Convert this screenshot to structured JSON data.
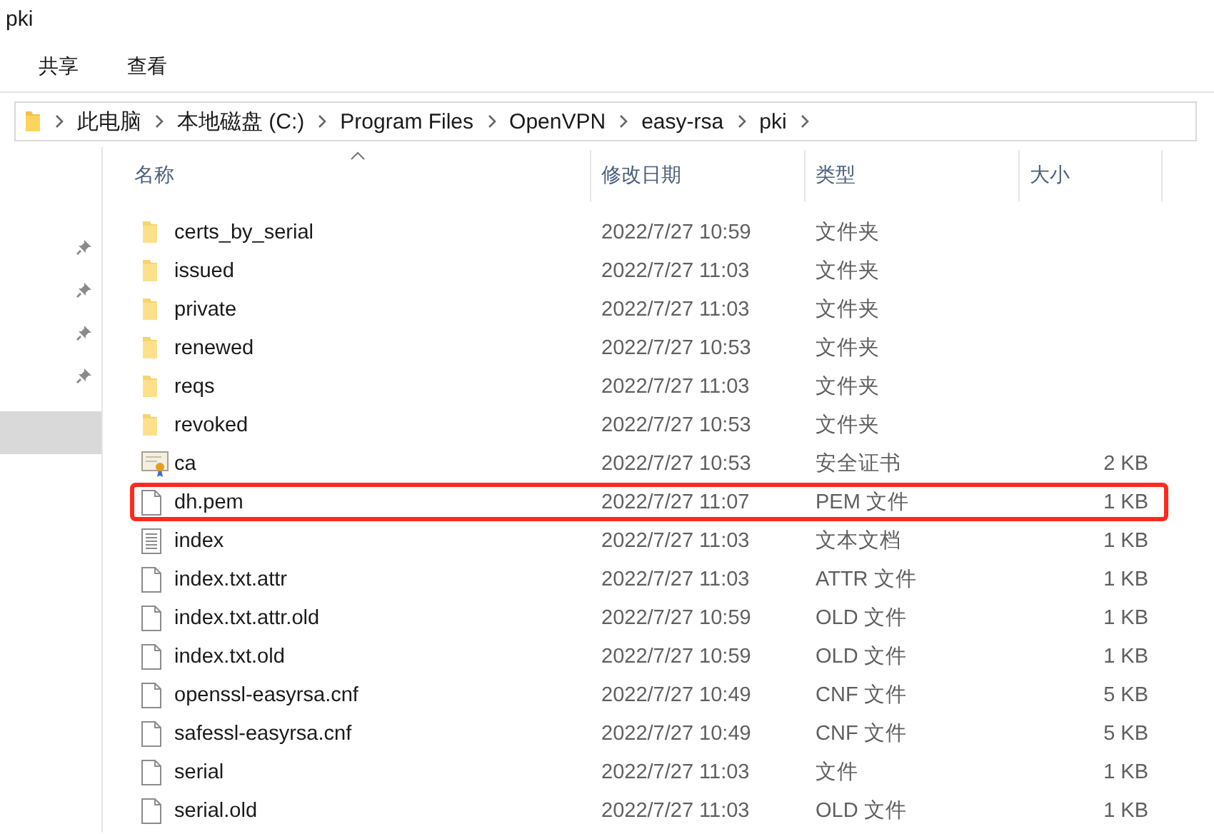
{
  "window": {
    "title": "pki"
  },
  "ribbon_tabs": [
    "共享",
    "查看"
  ],
  "breadcrumb": [
    "此电脑",
    "本地磁盘 (C:)",
    "Program Files",
    "OpenVPN",
    "easy-rsa",
    "pki"
  ],
  "nav_items": [
    {
      "pinned": true,
      "selected": false
    },
    {
      "pinned": true,
      "selected": false
    },
    {
      "pinned": true,
      "selected": false
    },
    {
      "pinned": true,
      "selected": false
    },
    {
      "pinned": false,
      "selected": true
    }
  ],
  "columns": [
    "名称",
    "修改日期",
    "类型",
    "大小"
  ],
  "rows": [
    {
      "kind": "folder",
      "name": "certs_by_serial",
      "modified": "2022/7/27 10:59",
      "type": "文件夹",
      "highlighted": false
    },
    {
      "kind": "folder",
      "name": "issued",
      "modified": "2022/7/27 11:03",
      "type": "文件夹",
      "highlighted": false
    },
    {
      "kind": "folder",
      "name": "private",
      "modified": "2022/7/27 11:03",
      "type": "文件夹",
      "highlighted": false
    },
    {
      "kind": "folder",
      "name": "renewed",
      "modified": "2022/7/27 10:53",
      "type": "文件夹",
      "highlighted": false
    },
    {
      "kind": "folder",
      "name": "reqs",
      "modified": "2022/7/27 11:03",
      "type": "文件夹",
      "highlighted": false
    },
    {
      "kind": "folder",
      "name": "revoked",
      "modified": "2022/7/27 10:53",
      "type": "文件夹",
      "highlighted": false
    },
    {
      "kind": "certificate",
      "name": "ca",
      "modified": "2022/7/27 10:53",
      "type": "安全证书",
      "size": "2 KB",
      "highlighted": false
    },
    {
      "kind": "file",
      "name": "dh.pem",
      "modified": "2022/7/27 11:07",
      "type": "PEM 文件",
      "size": "1 KB",
      "highlighted": true
    },
    {
      "kind": "text",
      "name": "index",
      "modified": "2022/7/27 11:03",
      "type": "文本文档",
      "size": "1 KB",
      "highlighted": false
    },
    {
      "kind": "file",
      "name": "index.txt.attr",
      "modified": "2022/7/27 11:03",
      "type": "ATTR 文件",
      "size": "1 KB",
      "highlighted": false
    },
    {
      "kind": "file",
      "name": "index.txt.attr.old",
      "modified": "2022/7/27 10:59",
      "type": "OLD 文件",
      "size": "1 KB",
      "highlighted": false
    },
    {
      "kind": "file",
      "name": "index.txt.old",
      "modified": "2022/7/27 10:59",
      "type": "OLD 文件",
      "size": "1 KB",
      "highlighted": false
    },
    {
      "kind": "file",
      "name": "openssl-easyrsa.cnf",
      "modified": "2022/7/27 10:49",
      "type": "CNF 文件",
      "size": "5 KB",
      "highlighted": false
    },
    {
      "kind": "file",
      "name": "safessl-easyrsa.cnf",
      "modified": "2022/7/27 10:49",
      "type": "CNF 文件",
      "size": "5 KB",
      "highlighted": false
    },
    {
      "kind": "file",
      "name": "serial",
      "modified": "2022/7/27 11:03",
      "type": "文件",
      "size": "1 KB",
      "highlighted": false
    },
    {
      "kind": "file",
      "name": "serial.old",
      "modified": "2022/7/27 11:03",
      "type": "OLD 文件",
      "size": "1 KB",
      "highlighted": false
    }
  ]
}
